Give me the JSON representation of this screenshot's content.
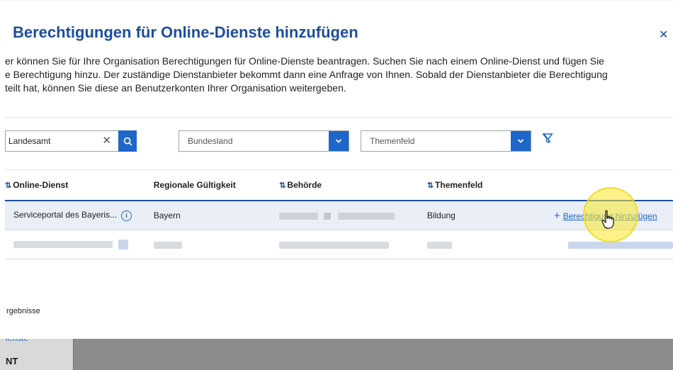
{
  "dialog": {
    "title": "Berechtigungen für Online-Dienste hinzufügen",
    "close_icon": "close-icon",
    "intro_lines": [
      "er können Sie für Ihre Organisation Berechtigungen für Online-Dienste beantragen. Suchen Sie nach einem Online-Dienst und fügen Sie",
      "e Berechtigung hinzu. Der zuständige Dienstanbieter bekommt dann eine Anfrage von Ihnen. Sobald der Dienstanbieter die Berechtigung",
      "teilt hat, können Sie diese an Benutzerkonten Ihrer Organisation weitergeben."
    ]
  },
  "filters": {
    "search_value": "Landesamt",
    "bundesland_label": "Bundesland",
    "themenfeld_label": "Themenfeld"
  },
  "table": {
    "columns": [
      "Online-Dienst",
      "Regionale Gültigkeit",
      "Behörde",
      "Themenfeld"
    ],
    "rows": [
      {
        "online_dienst": "Serviceportal des Bayeris...",
        "regionale_gueltigkeit": "Bayern",
        "behoerde": "",
        "themenfeld": "Bildung",
        "action_label": "Berechtigung hinzufügen"
      },
      {
        "online_dienst": "",
        "regionale_gueltigkeit": "",
        "behoerde": "",
        "themenfeld": "",
        "action_label": ""
      }
    ]
  },
  "results_label": "rgebnisse",
  "background": {
    "sidebar_link": "ienste",
    "sidebar_strong": "NT"
  },
  "colors": {
    "primary": "#1e66c9",
    "title": "#1d4e9e",
    "selected_row": "#e9eef7",
    "highlight": "#f5e428"
  }
}
